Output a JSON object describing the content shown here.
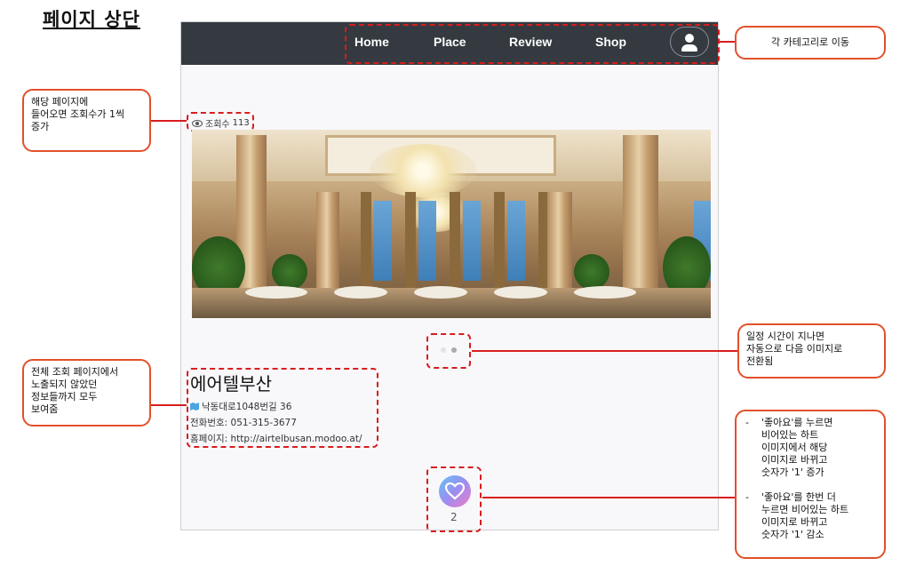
{
  "page_title": "페이지 상단",
  "nav": {
    "items": [
      "Home",
      "Place",
      "Review",
      "Shop"
    ],
    "profile_icon": "user-icon",
    "background": "#343a40"
  },
  "views": {
    "label": "조회수",
    "count": "113",
    "icon": "eye-icon"
  },
  "carousel": {
    "total": 2,
    "active_index": 1
  },
  "venue": {
    "name": "에어텔부산",
    "address": "낙동대로1048번길 36",
    "phone_label": "전화번호:",
    "phone": "051-315-3677",
    "homepage_label": "홈페이지:",
    "homepage": "http://airtelbusan.modoo.at/"
  },
  "like": {
    "count": "2",
    "icon": "heart-icon"
  },
  "callouts": {
    "nav": "각 카테고리로 이동",
    "views": "해당 페이지에\n들어오면 조회수가 1씩\n증가",
    "carousel": "일정 시간이 지나면\n자동으로 다음 이미지로\n전환됨",
    "info": "전체 조회 페이지에서\n노출되지 않았던\n정보들까지 모두\n보여줌",
    "like": [
      {
        "bullet": "-",
        "text": "'좋아요'를 누르면\n비어있는 하트\n이미지에서 해당\n이미지로 바뀌고\n숫자가 '1' 증가"
      },
      {
        "bullet": "-",
        "text": "'좋아요'를 한번 더\n누르면 비어있는 하트\n이미지로 바뀌고\n숫자가 '1' 감소"
      }
    ]
  },
  "colors": {
    "annotation_red": "#d81d1d",
    "callout_border": "#e2502a"
  }
}
